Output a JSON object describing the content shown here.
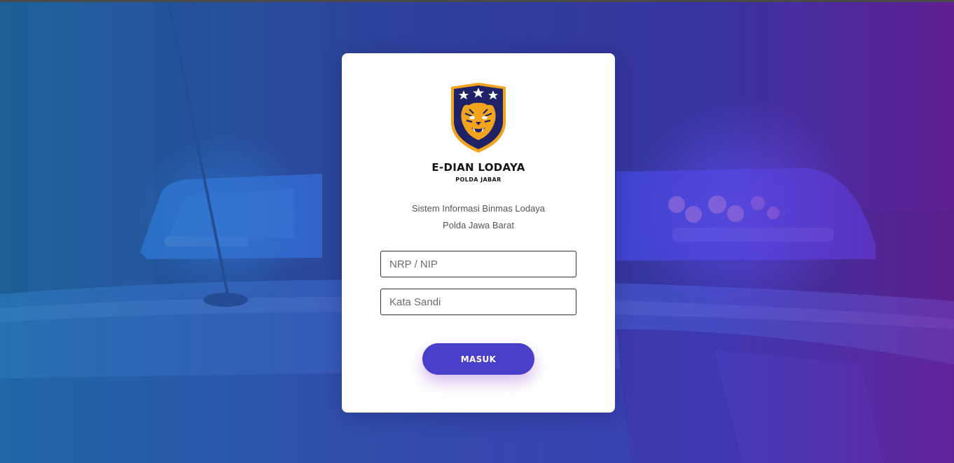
{
  "brand": {
    "title": "E-DIAN LODAYA",
    "subtitle": "POLDA JABAR"
  },
  "description": {
    "line1": "Sistem Informasi Binmas Lodaya",
    "line2": "Polda Jawa Barat"
  },
  "form": {
    "username_placeholder": "NRP / NIP",
    "username_value": "",
    "password_placeholder": "Kata Sandi",
    "password_value": "",
    "submit_label": "MASUK"
  },
  "colors": {
    "accent": "#4a3fcb",
    "gradient_left": "#1e78b4",
    "gradient_mid": "#4a40cc",
    "gradient_right": "#7a1fa8",
    "shield_navy": "#1f2266",
    "shield_gold": "#f2a51c"
  },
  "icons": {
    "logo": "tiger-shield-emblem",
    "stars": "star-icon"
  }
}
